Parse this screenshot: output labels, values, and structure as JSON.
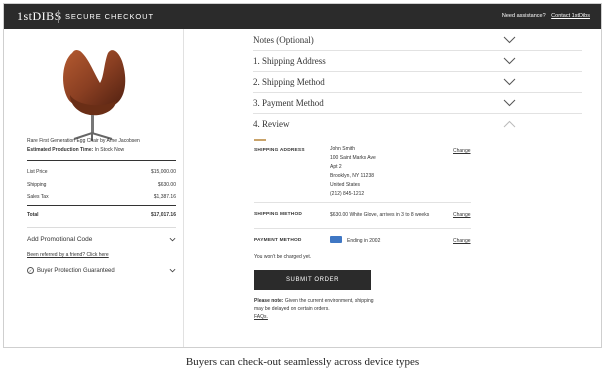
{
  "header": {
    "logo": "1stDIBS",
    "title": "SECURE CHECKOUT",
    "assist": "Need assistance?",
    "contact": "Contact 1stDibs"
  },
  "product": {
    "name": "Rare First Generation Egg Chair by Arne Jacobsen",
    "time_label": "Estimated Production Time:",
    "time_value": "In Stock Now",
    "image_icon": "egg-chair-image"
  },
  "summary": {
    "rows": [
      {
        "label": "List Price",
        "value": "$15,000.00"
      },
      {
        "label": "Shipping",
        "value": "$630.00"
      },
      {
        "label": "Sales Tax",
        "value": "$1,387.16"
      }
    ],
    "total_label": "Total",
    "total_value": "$17,017.16"
  },
  "promo": {
    "label": "Add Promotional Code",
    "referred": "Been referred by a friend? Click here",
    "protection": "Buyer Protection Guaranteed"
  },
  "sections": [
    {
      "label": "Notes (Optional)"
    },
    {
      "label": "1. Shipping Address"
    },
    {
      "label": "2. Shipping Method"
    },
    {
      "label": "3. Payment Method"
    },
    {
      "label": "4. Review"
    }
  ],
  "review": {
    "address_key": "SHIPPING ADDRESS",
    "address_lines": [
      "John Smith",
      "100 Saint Marks Ave",
      "Apt 2",
      "Brooklyn, NY 11238",
      "United States",
      "(212) 845-1212"
    ],
    "method_key": "SHIPPING METHOD",
    "method_value": "$630.00 White Glove, arrives in 3 to 8 weeks",
    "payment_key": "PAYMENT METHOD",
    "payment_value": "Ending in 2002",
    "change": "Change",
    "not_charged": "You won't be charged yet.",
    "submit": "SUBMIT ORDER",
    "note_bold": "Please note:",
    "note_text": "Given the current environment, shipping may be delayed on certain orders.",
    "faqs": "FAQs."
  },
  "caption": "Buyers can check-out seamlessly across device types",
  "colors": {
    "topbar": "#2b2b2b",
    "accent": "#c9a36a",
    "amex": "#3f77c4",
    "chair_leather": "#8a3f22"
  }
}
